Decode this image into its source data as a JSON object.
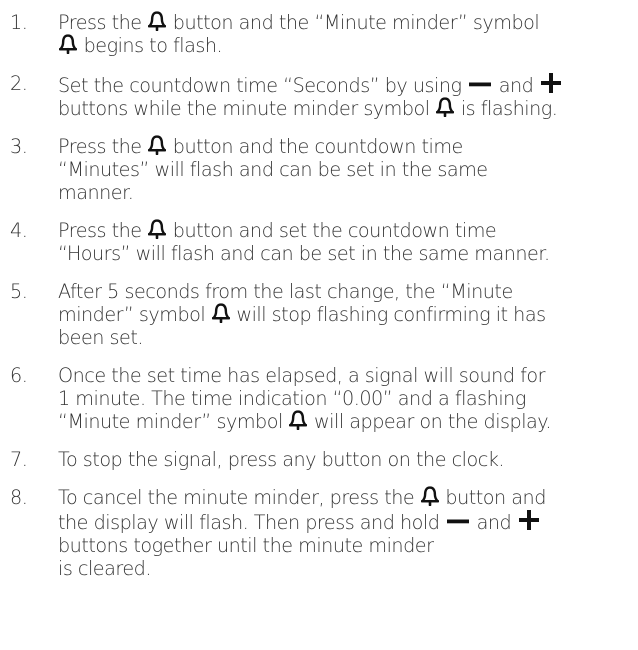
{
  "icons": {
    "bell": "minute-minder-bell-icon",
    "minus": "minus-icon",
    "plus": "plus-icon"
  },
  "steps": [
    {
      "number": "1.",
      "lines": [
        [
          "Press the ",
          "@bell",
          " button and the “Minute minder” symbol"
        ],
        [
          "@bell",
          " begins to flash."
        ]
      ]
    },
    {
      "number": "2.",
      "lines": [
        [
          "Set the countdown time “Seconds” by using ",
          "@minus",
          " and ",
          "@plus"
        ],
        [
          "buttons while the minute minder symbol ",
          "@bell",
          " is flashing."
        ]
      ]
    },
    {
      "number": "3.",
      "lines": [
        [
          "Press the ",
          "@bell",
          " button and the countdown time"
        ],
        [
          "“Minutes” will flash and can be set in the same"
        ],
        [
          "manner."
        ]
      ]
    },
    {
      "number": "4.",
      "lines": [
        [
          "Press the ",
          "@bell",
          " button and set the countdown time"
        ],
        [
          "“Hours” will flash and can be set in the same manner."
        ]
      ]
    },
    {
      "number": "5.",
      "lines": [
        [
          "After 5 seconds from the last change, the “Minute"
        ],
        [
          "minder” symbol ",
          "@bell",
          " will stop flashing confirming it has"
        ],
        [
          "been set."
        ]
      ]
    },
    {
      "number": "6.",
      "lines": [
        [
          "Once the set time has elapsed, a signal will sound for"
        ],
        [
          "1 minute. The time indication “0.00” and a flashing"
        ],
        [
          "“Minute minder” symbol ",
          "@bell",
          " will appear on the display."
        ]
      ]
    },
    {
      "number": "7.",
      "lines": [
        [
          "To stop the signal, press any button on the clock."
        ]
      ]
    },
    {
      "number": "8.",
      "lines": [
        [
          "To cancel the minute minder, press the ",
          "@bell",
          " button and"
        ],
        [
          "the display will flash. Then press and hold ",
          "@minus",
          " and ",
          "@plus"
        ],
        [
          "buttons together until the minute minder"
        ],
        [
          "is cleared."
        ]
      ]
    }
  ]
}
